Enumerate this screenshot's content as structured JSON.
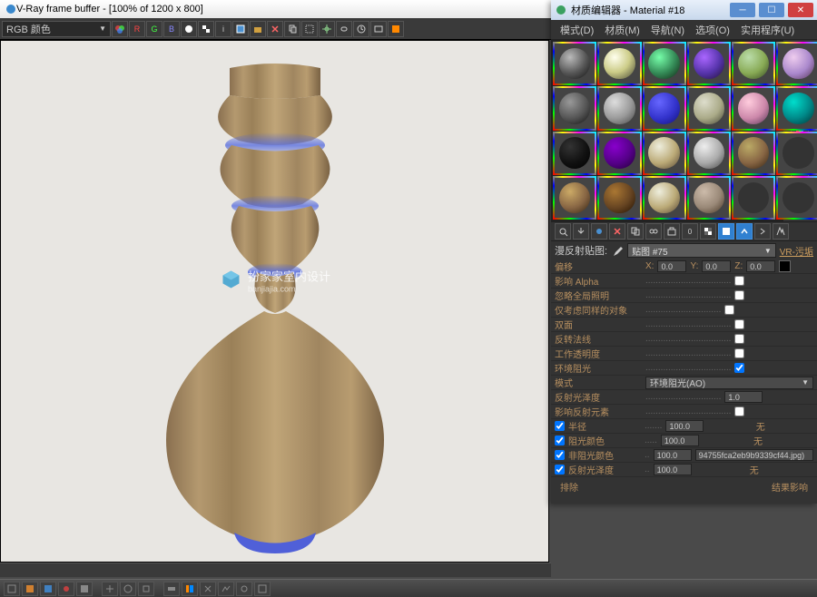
{
  "vray": {
    "title": "V-Ray frame buffer - [100% of 1200 x 800]",
    "channel_dropdown": "RGB 颜色",
    "toolbar": {
      "R": "R",
      "G": "G",
      "B": "B"
    }
  },
  "watermark": {
    "text": "扮家家室内设计",
    "sub": "banjiajia.com"
  },
  "material_editor": {
    "title": "材质编辑器 - Material #18",
    "menus": [
      "模式(D)",
      "材质(M)",
      "导航(N)",
      "选项(O)",
      "实用程序(U)"
    ],
    "slots": [
      {
        "c": "radial-gradient(circle at 35% 30%,#bbb,#555 55%,#111)"
      },
      {
        "c": "radial-gradient(circle at 35% 30%,#ffe,#cc8 50%,#443)"
      },
      {
        "c": "radial-gradient(circle at 35% 30%,#7fa,#385 55%,#121)"
      },
      {
        "c": "radial-gradient(circle at 35% 30%,#a6f,#53a 55%,#213)"
      },
      {
        "c": "radial-gradient(circle at 35% 30%,#bda,#8a5 55%,#342)"
      },
      {
        "c": "radial-gradient(circle at 35% 30%,#ece,#a8c 55%,#535)"
      },
      {
        "c": "radial-gradient(circle at 35% 30%,#999,#555 55%,#111)"
      },
      {
        "c": "radial-gradient(circle at 35% 30%,#ddd,#999 55%,#444)"
      },
      {
        "c": "radial-gradient(circle at 35% 30%,#66f,#33c 55%,#117)"
      },
      {
        "c": "radial-gradient(circle at 35% 30%,#ddc,#aa8 55%,#443)"
      },
      {
        "c": "radial-gradient(circle at 35% 30%,#fcd,#c8a 55%,#535)"
      },
      {
        "c": "radial-gradient(circle at 35% 30%,#0dc,#088 55%,#033)"
      },
      {
        "c": "radial-gradient(circle at 35% 30%,#333,#111 55%,#000)"
      },
      {
        "c": "radial-gradient(circle at 35% 30%,#80c,#508 55%,#203)"
      },
      {
        "c": "radial-gradient(circle at 35% 30%,#eed,#ba7 55%,#543)"
      },
      {
        "c": "radial-gradient(circle at 35% 30%,#eee,#aaa 55%,#444)"
      },
      {
        "c": "radial-gradient(circle at 35% 30%,#ba6,#864 55%,#321)"
      },
      {
        "c": "#333"
      },
      {
        "c": "radial-gradient(circle at 35% 30%,#ca6,#864 55%,#321)"
      },
      {
        "c": "radial-gradient(circle at 35% 30%,#a73,#642 55%,#210)"
      },
      {
        "c": "radial-gradient(circle at 35% 30%,#eed,#ba7 55%,#543)"
      },
      {
        "c": "radial-gradient(circle at 35% 30%,#cba,#987 55%,#432)"
      },
      {
        "c": "#333"
      },
      {
        "c": "#333"
      }
    ],
    "param_header": {
      "label": "漫反射贴图:",
      "map_name": "贴图 #75",
      "map_type": "VR-污垢"
    },
    "params": {
      "offset_label": "偏移",
      "offset_x": "0.0",
      "offset_y": "0.0",
      "offset_z": "0.0",
      "affect_alpha": "影响 Alpha",
      "ignore_gi": "忽略全局照明",
      "same_objects": "仅考虑同样的对象",
      "double_sided": "双面",
      "invert_normal": "反转法线",
      "work_transparency": "工作透明度",
      "env_occlusion_label": "环境阻光",
      "mode_label": "模式",
      "mode_value": "环境阻光(AO)",
      "refl_gloss": "反射光泽度",
      "refl_gloss_val": "1.0",
      "affect_refl": "影响反射元素",
      "radius": "半径",
      "radius_val": "100.0",
      "radius_txt": "无",
      "occ_color": "阻光颜色",
      "occ_val": "100.0",
      "occ_txt": "无",
      "unocc_color": "非阻光颜色",
      "unocc_val": "100.0",
      "unocc_file": "94755fca2eb9b9339cf44.jpg)",
      "refl_gloss2": "反射光泽度",
      "refl2_val": "100.0",
      "refl2_txt": "无",
      "exclude": "排除",
      "result_affect": "结果影响"
    }
  }
}
